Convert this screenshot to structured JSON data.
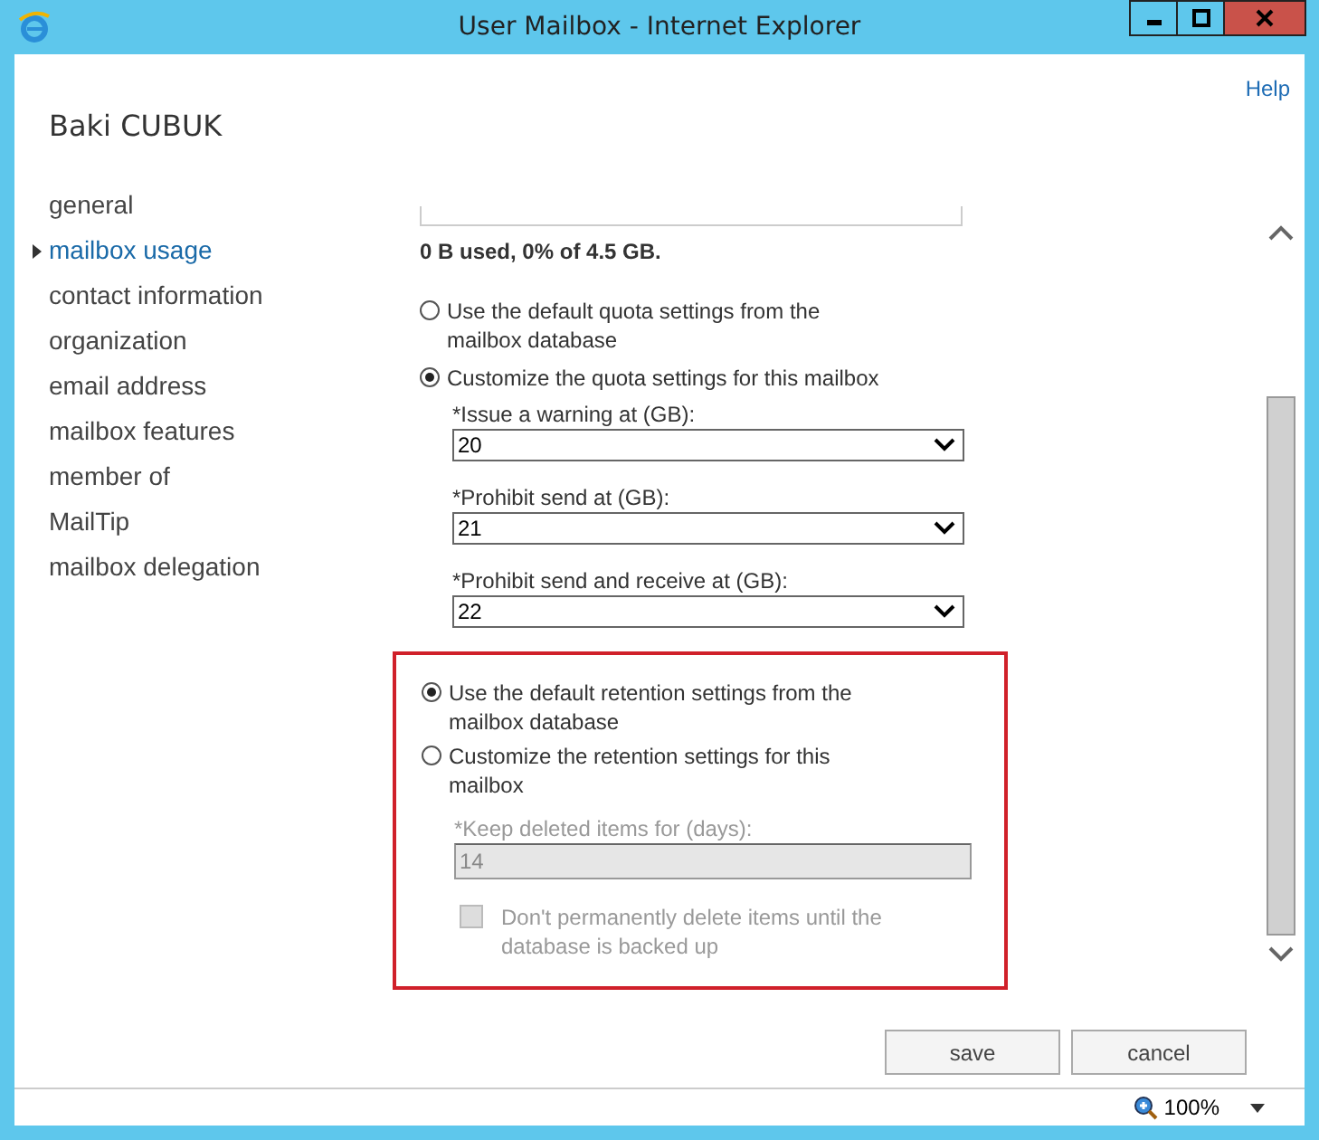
{
  "window": {
    "title": "User Mailbox - Internet Explorer"
  },
  "help_link": "Help",
  "user_name": "Baki CUBUK",
  "nav": [
    {
      "label": "general",
      "selected": false
    },
    {
      "label": "mailbox usage",
      "selected": true
    },
    {
      "label": "contact information",
      "selected": false
    },
    {
      "label": "organization",
      "selected": false
    },
    {
      "label": "email address",
      "selected": false
    },
    {
      "label": "mailbox features",
      "selected": false
    },
    {
      "label": "member of",
      "selected": false
    },
    {
      "label": "MailTip",
      "selected": false
    },
    {
      "label": "mailbox delegation",
      "selected": false
    }
  ],
  "mailbox_usage": {
    "usage_text": "0 B used, 0% of 4.5 GB.",
    "quota_options": [
      {
        "label": "Use the default quota settings from the mailbox database",
        "selected": false
      },
      {
        "label": "Customize the quota settings for this mailbox",
        "selected": true
      }
    ],
    "quota_fields": [
      {
        "label": "*Issue a warning at (GB):",
        "value": "20"
      },
      {
        "label": "*Prohibit send at (GB):",
        "value": "21"
      },
      {
        "label": "*Prohibit send and receive at (GB):",
        "value": "22"
      }
    ]
  },
  "retention": {
    "highlighted": true,
    "options": [
      {
        "label": "Use the default retention settings from the mailbox database",
        "selected": true
      },
      {
        "label": "Customize the retention settings for this mailbox",
        "selected": false
      }
    ],
    "keep_deleted": {
      "label": "*Keep deleted items for (days):",
      "value": "14",
      "disabled": true
    },
    "backup_checkbox": {
      "label": "Don't permanently delete items until the database is backed up",
      "checked": false,
      "disabled": true
    }
  },
  "buttons": [
    "save",
    "cancel"
  ],
  "status_bar": {
    "zoom": "100%"
  }
}
